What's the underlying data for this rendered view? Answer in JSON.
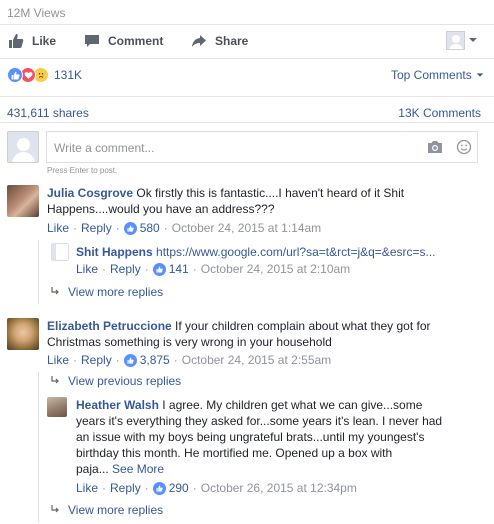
{
  "post": {
    "views": "12M Views",
    "actions": {
      "like": "Like",
      "comment": "Comment",
      "share": "Share"
    },
    "reactions_count": "131K",
    "top_comments": "Top Comments",
    "shares": "431,611 shares",
    "comments_count": "13K Comments"
  },
  "composer": {
    "placeholder": "Write a comment...",
    "hint": "Press Enter to post."
  },
  "comments": [
    {
      "author": "Julia Cosgrove",
      "text_line1": "Ok firstly this is fantastic....I haven't heard of it Shit",
      "text_line2": "Happens....would you have an address???",
      "like": "Like",
      "reply": "Reply",
      "likes": "580",
      "time": "October 24, 2015 at 1:14am",
      "reply_item": {
        "author": "Shit Happens",
        "text": "https://www.google.com/url?sa=t&rct=j&q=&esrc=s...",
        "like": "Like",
        "reply": "Reply",
        "likes": "141",
        "time": "October 24, 2015 at 2:10am"
      },
      "view_more": "View more replies"
    },
    {
      "author": "Elizabeth Petruccione",
      "text_line1": "If your children complain about what they got for",
      "text_line2": "Christmas something is very wrong in your household",
      "like": "Like",
      "reply": "Reply",
      "likes": "3,875",
      "time": "October 24, 2015 at 2:55am",
      "view_previous": "View previous replies",
      "reply_item": {
        "author": "Heather Walsh",
        "text_line1": "I agree. My children get what we can give...some",
        "text_line2": "years it's everything they asked for...some years it's lean. I never had",
        "text_line3": "an issue with my boys being ungrateful brats...until my youngest's",
        "text_line4": "birthday this month. He mortified me. Opened up a box with",
        "text_line5": "paja...",
        "see_more": "See More",
        "like": "Like",
        "reply": "Reply",
        "likes": "290",
        "time": "October 26, 2015 at 12:34pm"
      },
      "view_more": "View more replies"
    }
  ],
  "colors": {
    "link": "#365899",
    "muted": "#90949c",
    "like_blue": "#5890ff",
    "love_red": "#f25268",
    "haha_yellow": "#fbcd46"
  }
}
